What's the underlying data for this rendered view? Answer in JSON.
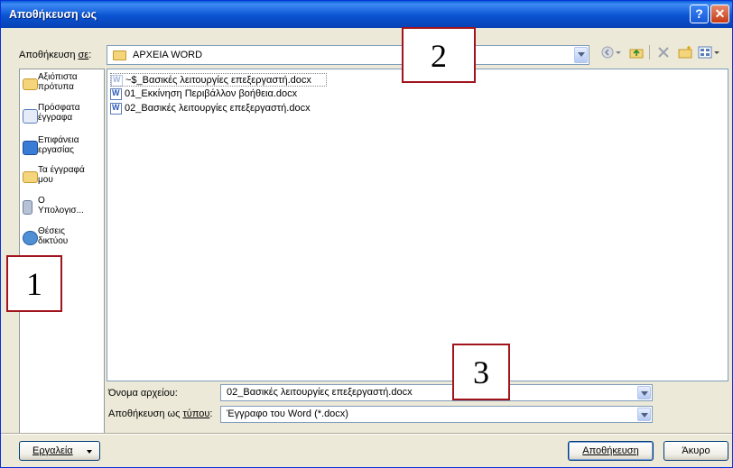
{
  "dialog": {
    "title": "Αποθήκευση ως",
    "help_glyph": "?",
    "close_glyph": "✕"
  },
  "savein": {
    "label_pre": "Αποθήκευση ",
    "label_accel": "σε",
    "label_post": ":",
    "value": "ΑΡΧΕΙΑ WORD"
  },
  "toolbar": {
    "icons": [
      "back-icon",
      "up-folder-icon",
      "delete-icon",
      "new-folder-icon",
      "views-icon"
    ]
  },
  "sidebar": {
    "items": [
      {
        "line1": "Αξιόπιστα",
        "line2": "πρότυπα",
        "icon": "trusted-templates-folder-icon"
      },
      {
        "line1": "Πρόσφατα",
        "line2": "έγγραφα",
        "icon": "recent-documents-icon"
      },
      {
        "line1": "Επιφάνεια",
        "line2": "εργασίας",
        "icon": "desktop-icon"
      },
      {
        "line1": "Τα έγγραφά",
        "line2": "μου",
        "icon": "my-documents-icon"
      },
      {
        "line1": "Ο",
        "line2": "Υπολογισ...",
        "icon": "my-computer-icon"
      },
      {
        "line1": "Θέσεις",
        "line2": "δικτύου",
        "icon": "network-places-icon"
      }
    ]
  },
  "files": [
    {
      "name": "~$_Βασικές λειτουργίες επεξεργαστή.docx",
      "hidden": true
    },
    {
      "name": "01_Εκκίνηση Περιβάλλον βοήθεια.docx",
      "hidden": false
    },
    {
      "name": "02_Βασικές λειτουργίες επεξεργαστή.docx",
      "hidden": false
    }
  ],
  "filename": {
    "label": "Όνομα αρχείου:",
    "value": "02_Βασικές λειτουργίες επεξεργαστή.docx"
  },
  "filetype": {
    "label_pre": "Αποθήκευση ως ",
    "label_accel": "τύπου",
    "label_post": ":",
    "value": "Έγγραφο του Word (*.docx)"
  },
  "buttons": {
    "tools": "Εργαλεία",
    "save": "Αποθήκευση",
    "cancel": "Άκυρο"
  },
  "callouts": [
    "1",
    "2",
    "3"
  ]
}
